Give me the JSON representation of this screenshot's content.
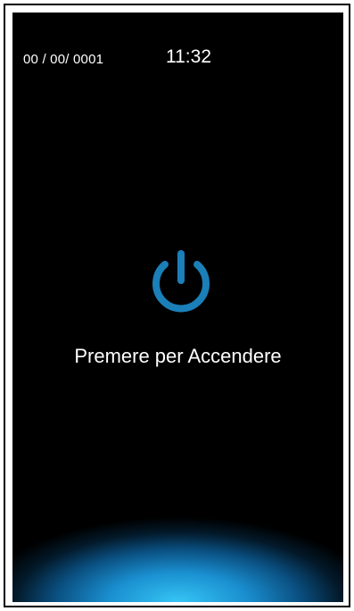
{
  "status_bar": {
    "date": "00 / 00/ 0001",
    "time": "11:32"
  },
  "power": {
    "icon": "power-icon",
    "color": "#1b7fb8"
  },
  "prompt": {
    "label": "Premere per Accendere"
  },
  "glow": {
    "color": "#36c6f4"
  }
}
